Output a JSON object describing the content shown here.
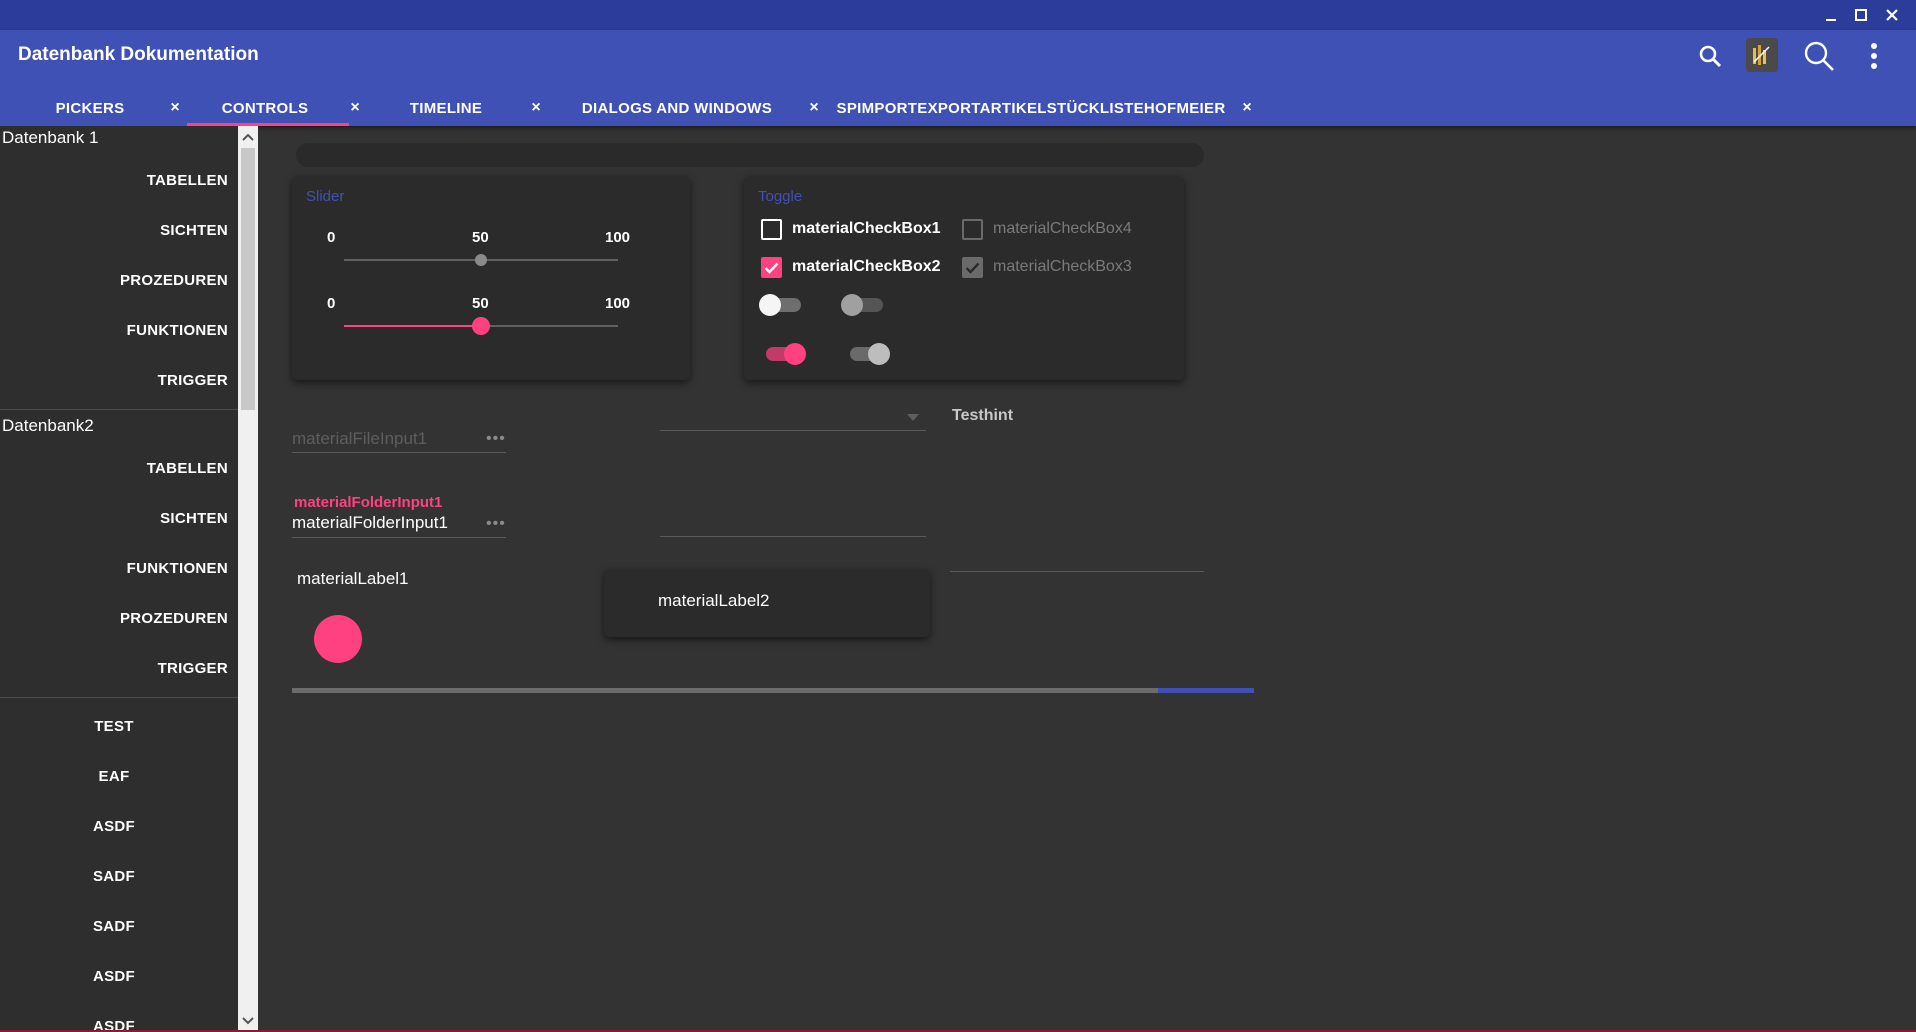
{
  "window": {
    "controls": [
      "minimize-icon",
      "maximize-icon",
      "close-icon"
    ]
  },
  "app": {
    "title": "Datenbank Dokumentation",
    "toolbar_icons": [
      "search-icon",
      "app-logo-icon",
      "search-large-icon",
      "more-vert-icon"
    ]
  },
  "tabs": [
    {
      "label": "PICKERS",
      "close": "×"
    },
    {
      "label": "CONTROLS",
      "close": "×",
      "active": true
    },
    {
      "label": "TIMELINE",
      "close": "×"
    },
    {
      "label": "DIALOGS AND WINDOWS",
      "close": "×"
    },
    {
      "label": "SPIMPORTEXPORTARTIKELSTÜCKLISTEHOFMEIER",
      "close": "×"
    }
  ],
  "sidebar": {
    "db1": {
      "title": "Datenbank 1",
      "items": [
        "TABELLEN",
        "SICHTEN",
        "PROZEDUREN",
        "FUNKTIONEN",
        "TRIGGER"
      ]
    },
    "db2": {
      "title": "Datenbank2",
      "items": [
        "TABELLEN",
        "SICHTEN",
        "FUNKTIONEN",
        "PROZEDUREN",
        "TRIGGER"
      ]
    },
    "extra_items": [
      "TEST",
      "EAF",
      "ASDF",
      "SADF",
      "SADF",
      "ASDF",
      "ASDF"
    ]
  },
  "slider_card": {
    "title": "Slider",
    "slider1": {
      "min_label": "0",
      "mid_label": "50",
      "max_label": "100",
      "value": 50,
      "enabled": false
    },
    "slider2": {
      "min_label": "0",
      "mid_label": "50",
      "max_label": "100",
      "value": 50,
      "enabled": true
    }
  },
  "toggle_card": {
    "title": "Toggle",
    "checkboxes": [
      {
        "label": "materialCheckBox1",
        "checked": false,
        "enabled": true
      },
      {
        "label": "materialCheckBox4",
        "checked": false,
        "enabled": false
      },
      {
        "label": "materialCheckBox2",
        "checked": true,
        "enabled": true
      },
      {
        "label": "materialCheckBox3",
        "checked": true,
        "enabled": false
      }
    ],
    "switches": [
      {
        "on": false,
        "enabled": true
      },
      {
        "on": false,
        "enabled": false
      },
      {
        "on": true,
        "enabled": true
      },
      {
        "on": true,
        "enabled": false
      }
    ]
  },
  "inputs": {
    "file_input": {
      "placeholder": "materialFileInput1",
      "dots": "•••"
    },
    "folder_input": {
      "floating_label": "materialFolderInput1",
      "value": "materialFolderInput1",
      "dots": "•••"
    },
    "combo": {
      "value": ""
    },
    "hint_label": "Testhint"
  },
  "labels": {
    "label1": "materialLabel1",
    "label2": "materialLabel2"
  },
  "progress": {
    "value_percent": 90
  },
  "colors": {
    "primary": "#3f51b5",
    "primary_dark": "#2b3c9a",
    "accent": "#ff4081",
    "background": "#333333",
    "sidebar": "#2e2e2e"
  }
}
